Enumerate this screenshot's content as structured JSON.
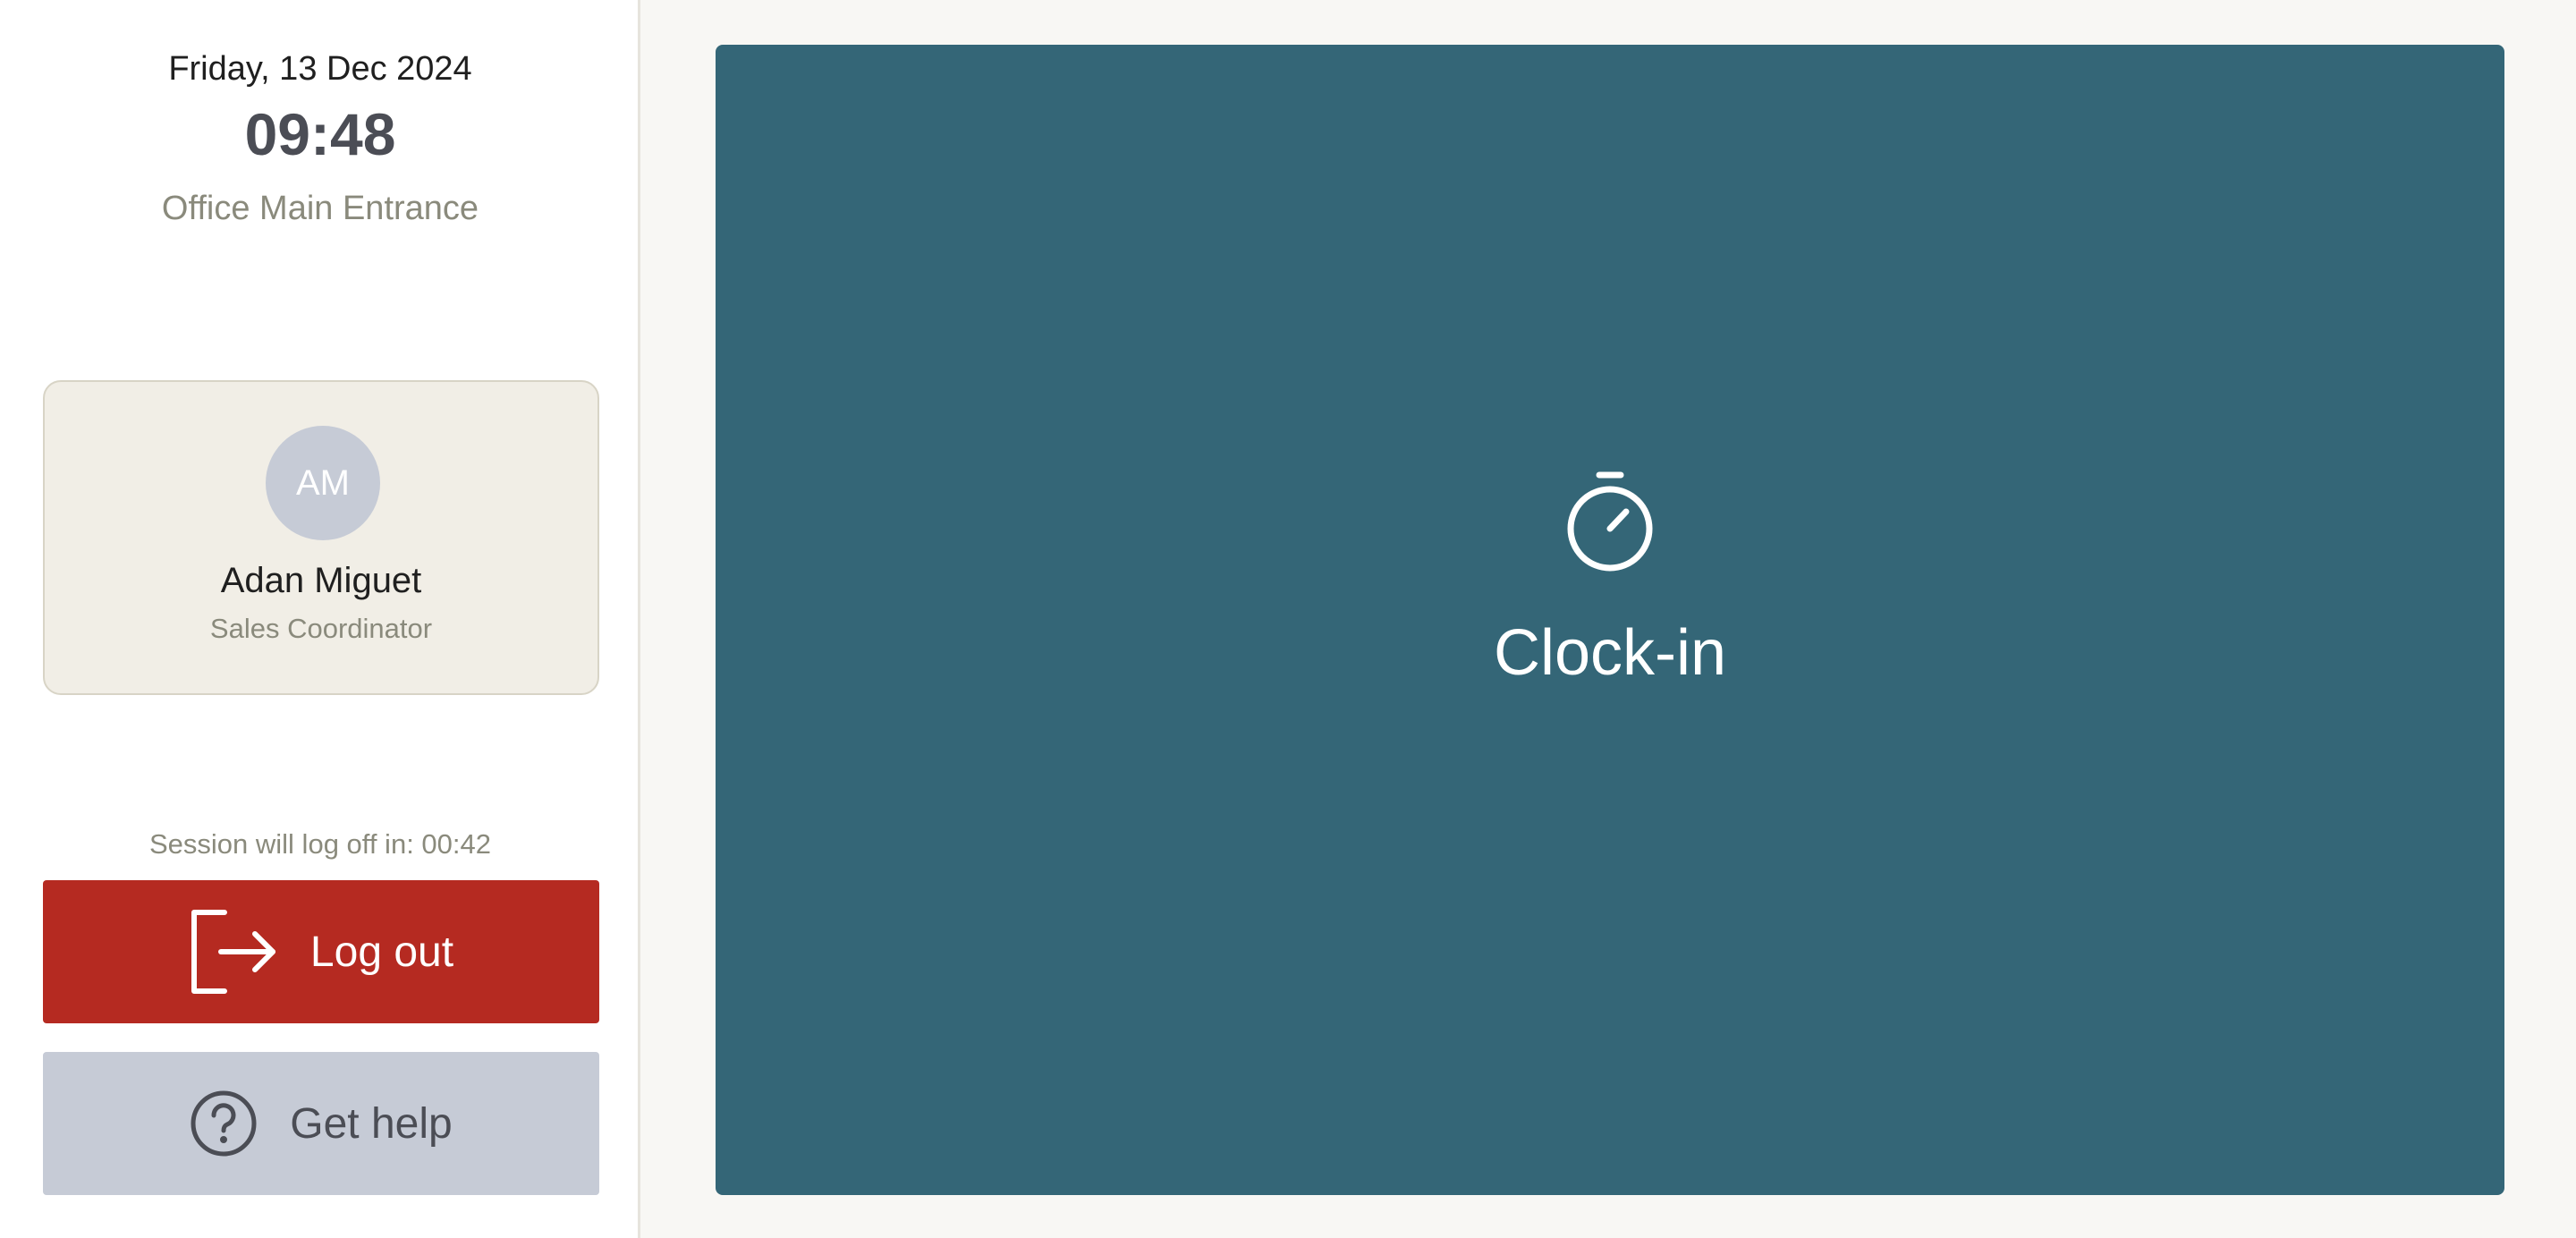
{
  "header": {
    "date": "Friday, 13 Dec 2024",
    "time": "09:48",
    "location": "Office Main Entrance"
  },
  "user": {
    "initials": "AM",
    "name": "Adan Miguet",
    "role": "Sales Coordinator"
  },
  "session": {
    "text": "Session will log off in: 00:42"
  },
  "actions": {
    "logout": {
      "label": "Log out",
      "icon": "logout-icon"
    },
    "help": {
      "label": "Get help",
      "icon": "help-circle-icon"
    }
  },
  "main": {
    "action_label": "Clock-in",
    "icon": "stopwatch-icon"
  },
  "colors": {
    "primary": "#346677",
    "danger": "#b52a21",
    "muted_button": "#c6cbd6",
    "card_bg": "#f1eee6"
  }
}
